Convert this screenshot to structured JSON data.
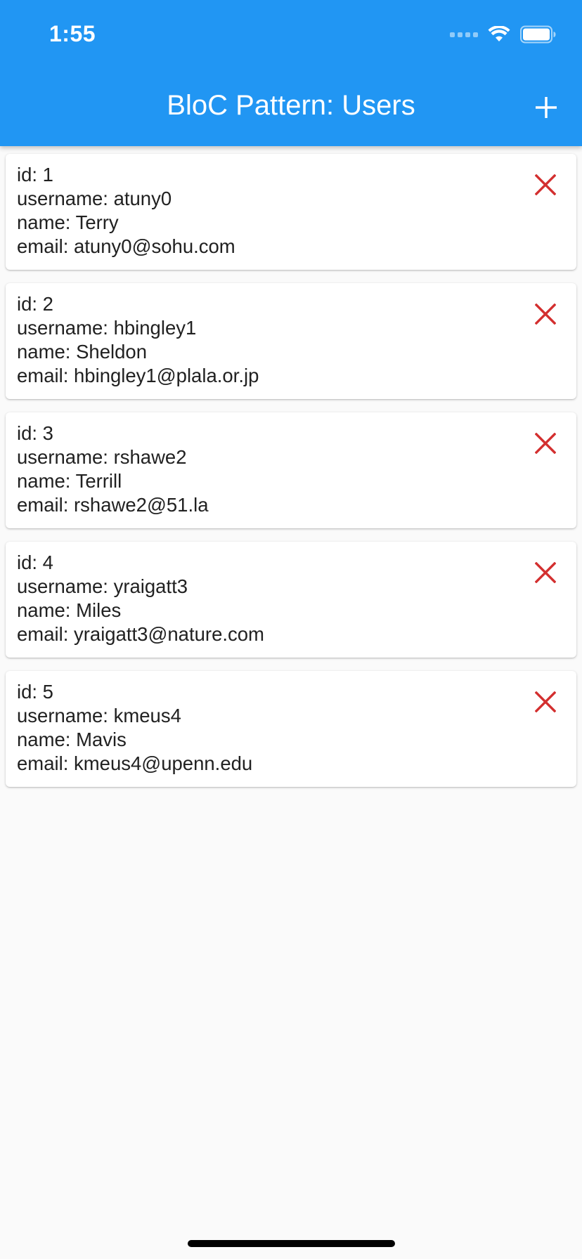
{
  "status_bar": {
    "time": "1:55"
  },
  "app_bar": {
    "title": "BloC Pattern: Users",
    "add_icon": "plus-icon"
  },
  "users": [
    {
      "id": "id: 1",
      "username": "username: atuny0",
      "name": "name: Terry",
      "email": "email: atuny0@sohu.com"
    },
    {
      "id": "id: 2",
      "username": "username: hbingley1",
      "name": "name: Sheldon",
      "email": "email: hbingley1@plala.or.jp"
    },
    {
      "id": "id: 3",
      "username": "username: rshawe2",
      "name": "name: Terrill",
      "email": "email: rshawe2@51.la"
    },
    {
      "id": "id: 4",
      "username": "username: yraigatt3",
      "name": "name: Miles",
      "email": "email: yraigatt3@nature.com"
    },
    {
      "id": "id: 5",
      "username": "username: kmeus4",
      "name": "name: Mavis",
      "email": "email: kmeus4@upenn.edu"
    }
  ],
  "colors": {
    "app_bar": "#2196f3",
    "delete_icon": "#d32f2f",
    "background": "#fafafa"
  }
}
